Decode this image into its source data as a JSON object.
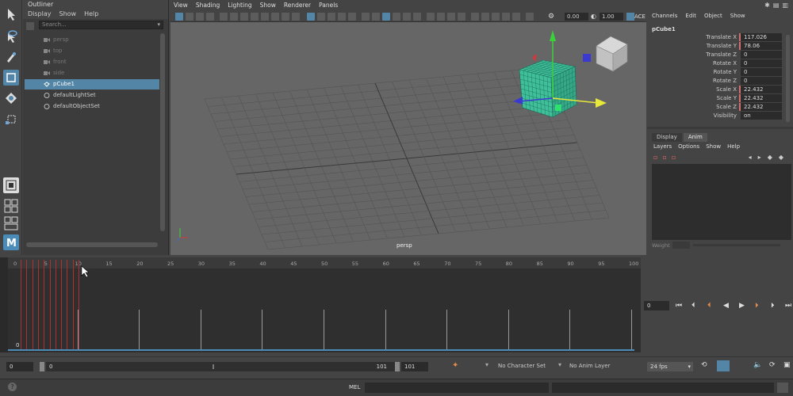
{
  "outliner": {
    "title": "Outliner",
    "menu": [
      "Display",
      "Show",
      "Help"
    ],
    "search_placeholder": "Search...",
    "items": [
      {
        "label": "persp",
        "state": "dim"
      },
      {
        "label": "top",
        "state": "dim"
      },
      {
        "label": "front",
        "state": "dim"
      },
      {
        "label": "side",
        "state": "dim"
      },
      {
        "label": "pCube1",
        "state": "selected"
      },
      {
        "label": "defaultLightSet",
        "state": "normal"
      },
      {
        "label": "defaultObjectSet",
        "state": "normal"
      }
    ]
  },
  "viewport": {
    "menu": [
      "View",
      "Shading",
      "Lighting",
      "Show",
      "Renderer",
      "Panels"
    ],
    "exposure": "0.00",
    "gamma": "1.00",
    "colorspace": "ACE",
    "camera_label": "persp"
  },
  "channel_box": {
    "menu": [
      "Channels",
      "Edit",
      "Object",
      "Show"
    ],
    "object_name": "pCube1",
    "attributes": [
      {
        "label": "Translate X",
        "value": "117.026",
        "keyed": true
      },
      {
        "label": "Translate Y",
        "value": "78.06",
        "keyed": true
      },
      {
        "label": "Translate Z",
        "value": "0",
        "keyed": false
      },
      {
        "label": "Rotate X",
        "value": "0",
        "keyed": false
      },
      {
        "label": "Rotate Y",
        "value": "0",
        "keyed": false
      },
      {
        "label": "Rotate Z",
        "value": "0",
        "keyed": false
      },
      {
        "label": "Scale X",
        "value": "22.432",
        "keyed": true
      },
      {
        "label": "Scale Y",
        "value": "22.432",
        "keyed": true
      },
      {
        "label": "Scale Z",
        "value": "22.432",
        "keyed": true
      },
      {
        "label": "Visibility",
        "value": "on",
        "keyed": false
      }
    ],
    "layer_tabs": [
      "Display",
      "Anim"
    ],
    "active_layer_tab": "Anim",
    "layer_menu": [
      "Layers",
      "Options",
      "Show",
      "Help"
    ],
    "weight_label": "Weight"
  },
  "timeline": {
    "tick_labels": [
      "0",
      "5",
      "10",
      "15",
      "20",
      "25",
      "30",
      "35",
      "40",
      "45",
      "50",
      "55",
      "60",
      "65",
      "70",
      "75",
      "80",
      "85",
      "90",
      "95",
      "100"
    ],
    "current_frame_marker": "0",
    "current_frame": "0"
  },
  "range": {
    "start": "0",
    "inner_start": "0",
    "inner_end": "101",
    "end": "101",
    "character_set": "No Character Set",
    "anim_layer": "No Anim Layer",
    "fps": "24 fps"
  },
  "command_line": {
    "lang": "MEL"
  }
}
